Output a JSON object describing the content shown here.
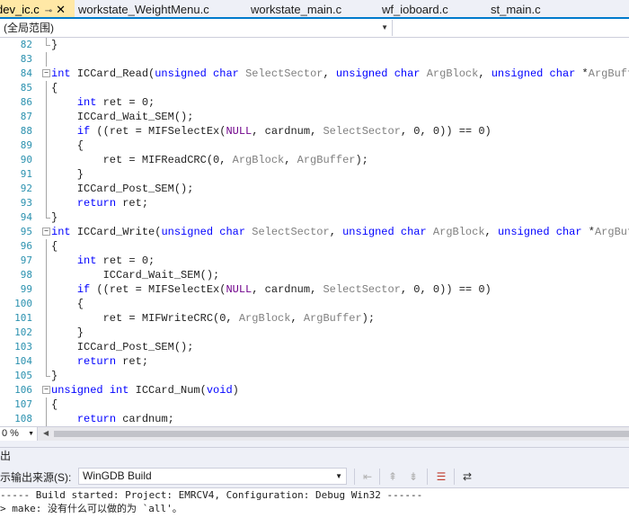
{
  "tabs": [
    {
      "label": "dev_ic.c",
      "active": true,
      "pin": "⊸",
      "close": "✕"
    },
    {
      "label": "workstate_WeightMenu.c"
    },
    {
      "label": "workstate_main.c"
    },
    {
      "label": "wf_ioboard.c"
    },
    {
      "label": "st_main.c"
    }
  ],
  "scope": {
    "value": "(全局范围)"
  },
  "editor": {
    "lines": [
      {
        "num": "82",
        "text": "}"
      },
      {
        "num": "83",
        "text": ""
      },
      {
        "num": "84",
        "text": "int ICCard_Read(unsigned char SelectSector, unsigned char ArgBlock, unsigned char *ArgBuffer)"
      },
      {
        "num": "85",
        "text": "{"
      },
      {
        "num": "86",
        "text": "    int ret = 0;"
      },
      {
        "num": "87",
        "text": "    ICCard_Wait_SEM();"
      },
      {
        "num": "88",
        "text": "    if ((ret = MIFSelectEx(NULL, cardnum, SelectSector, 0, 0)) == 0)"
      },
      {
        "num": "89",
        "text": "    {"
      },
      {
        "num": "90",
        "text": "        ret = MIFReadCRC(0, ArgBlock, ArgBuffer);"
      },
      {
        "num": "91",
        "text": "    }"
      },
      {
        "num": "92",
        "text": "    ICCard_Post_SEM();"
      },
      {
        "num": "93",
        "text": "    return ret;"
      },
      {
        "num": "94",
        "text": "}"
      },
      {
        "num": "95",
        "text": "int ICCard_Write(unsigned char SelectSector, unsigned char ArgBlock, unsigned char *ArgBuffer)"
      },
      {
        "num": "96",
        "text": "{"
      },
      {
        "num": "97",
        "text": "    int ret = 0;"
      },
      {
        "num": "98",
        "text": "        ICCard_Wait_SEM();"
      },
      {
        "num": "99",
        "text": "    if ((ret = MIFSelectEx(NULL, cardnum, SelectSector, 0, 0)) == 0)"
      },
      {
        "num": "100",
        "text": "    {"
      },
      {
        "num": "101",
        "text": "        ret = MIFWriteCRC(0, ArgBlock, ArgBuffer);"
      },
      {
        "num": "102",
        "text": "    }"
      },
      {
        "num": "103",
        "text": "    ICCard_Post_SEM();"
      },
      {
        "num": "104",
        "text": "    return ret;"
      },
      {
        "num": "105",
        "text": "}"
      },
      {
        "num": "106",
        "text": "unsigned int ICCard_Num(void)"
      },
      {
        "num": "107",
        "text": "{"
      },
      {
        "num": "108",
        "text": "    return cardnum;"
      }
    ]
  },
  "zoom": {
    "value": "0 %"
  },
  "output": {
    "title": "出",
    "source_label": "示输出来源(S):",
    "source_value": "WinGDB Build",
    "lines": [
      "----- Build started: Project: EMRCV4, Configuration: Debug Win32 ------",
      "> make: 没有什么可以做的为 `all'。"
    ]
  },
  "colors": {
    "keyword": "#0000ff",
    "param": "#808080",
    "macro": "#6f008a",
    "line_number": "#2b91af",
    "tab_active": "#ffe8a6",
    "accent": "#007acc"
  }
}
